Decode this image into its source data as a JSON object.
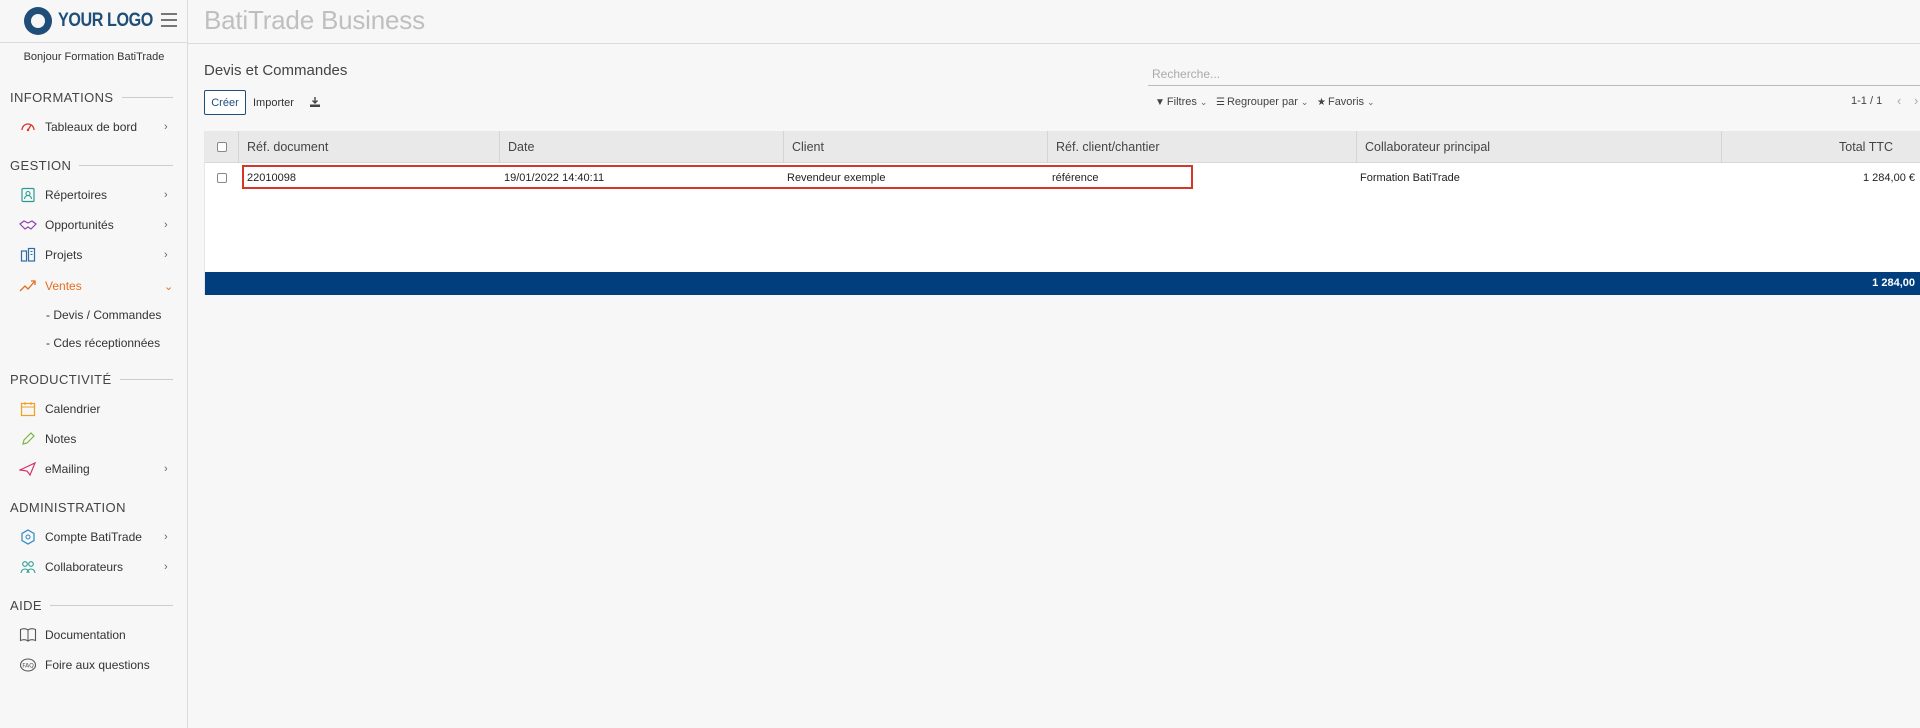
{
  "logo": {
    "text": "YOUR LOGO"
  },
  "app": {
    "title": "BatiTrade Business"
  },
  "sidebar": {
    "greeting": "Bonjour Formation BatiTrade",
    "sections": [
      {
        "title": "INFORMATIONS"
      },
      {
        "title": "GESTION"
      },
      {
        "title": "PRODUCTIVITÉ"
      },
      {
        "title": "ADMINISTRATION"
      },
      {
        "title": "AIDE"
      }
    ],
    "items": {
      "tableaux": {
        "label": "Tableaux de bord",
        "icon": "gauge-icon"
      },
      "repertoires": {
        "label": "Répertoires",
        "icon": "contacts-icon"
      },
      "opportunites": {
        "label": "Opportunités",
        "icon": "handshake-icon"
      },
      "projets": {
        "label": "Projets",
        "icon": "buildings-icon"
      },
      "ventes": {
        "label": "Ventes",
        "icon": "sales-chart-icon"
      },
      "calendrier": {
        "label": "Calendrier",
        "icon": "calendar-icon"
      },
      "notes": {
        "label": "Notes",
        "icon": "pencil-icon"
      },
      "emailing": {
        "label": "eMailing",
        "icon": "paper-plane-icon"
      },
      "compte": {
        "label": "Compte BatiTrade",
        "icon": "gear-cube-icon"
      },
      "collaborateurs": {
        "label": "Collaborateurs",
        "icon": "users-icon"
      },
      "documentation": {
        "label": "Documentation",
        "icon": "book-icon"
      },
      "faq": {
        "label": "Foire aux questions",
        "icon": "faq-icon"
      }
    },
    "subitems": {
      "devis": "- Devis / Commandes",
      "cdes": "- Cdes réceptionnées"
    }
  },
  "page": {
    "title": "Devis et Commandes",
    "create_label": "Créer",
    "import_label": "Importer"
  },
  "search": {
    "placeholder": "Recherche..."
  },
  "filters": {
    "filtres": "Filtres",
    "regrouper": "Regrouper par",
    "favoris": "Favoris"
  },
  "pager": {
    "text": "1-1 / 1"
  },
  "table": {
    "columns": {
      "ref": "Réf. document",
      "date": "Date",
      "client": "Client",
      "ref_client": "Réf. client/chantier",
      "collab": "Collaborateur principal",
      "total": "Total TTC"
    },
    "rows": [
      {
        "ref": "22010098",
        "date": "19/01/2022 14:40:11",
        "client": "Revendeur exemple",
        "ref_client": "référence",
        "collab": "Formation BatiTrade",
        "total": "1 284,00 €"
      }
    ],
    "footer_total": "1 284,00"
  },
  "colors": {
    "brand": "#1f4e79",
    "footer_bar": "#003e7e",
    "active_nav": "#e66d1f",
    "highlight": "#d8352a"
  }
}
